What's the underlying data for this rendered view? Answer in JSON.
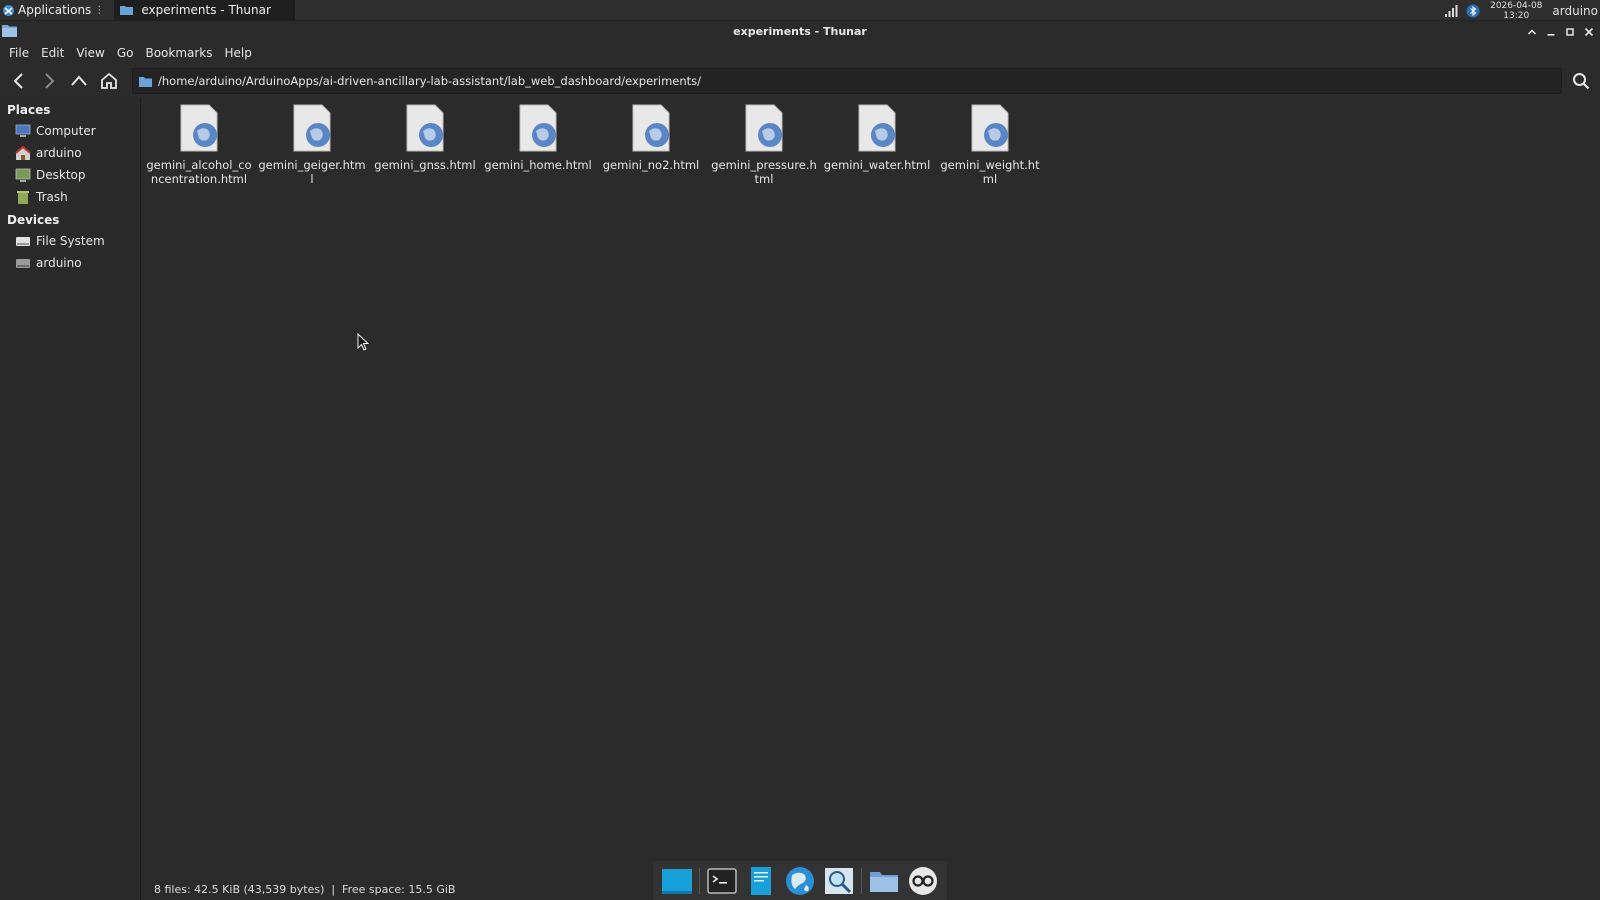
{
  "top_panel": {
    "applications_label": "Applications",
    "task_label": "experiments - Thunar",
    "clock_date": "2026-04-08",
    "clock_time": "13:20",
    "user": "arduino"
  },
  "window": {
    "title": "experiments - Thunar"
  },
  "menubar": {
    "items": [
      "File",
      "Edit",
      "View",
      "Go",
      "Bookmarks",
      "Help"
    ]
  },
  "toolbar": {
    "location": "/home/arduino/ArduinoApps/ai-driven-ancillary-lab-assistant/lab_web_dashboard/experiments/"
  },
  "sidebar": {
    "places_header": "Places",
    "places": [
      {
        "label": "Computer",
        "icon": "computer-icon"
      },
      {
        "label": "arduino",
        "icon": "home-icon"
      },
      {
        "label": "Desktop",
        "icon": "desktop-icon"
      },
      {
        "label": "Trash",
        "icon": "trash-icon"
      }
    ],
    "devices_header": "Devices",
    "devices": [
      {
        "label": "File System",
        "icon": "drive-icon"
      },
      {
        "label": "arduino",
        "icon": "drive-icon"
      }
    ]
  },
  "files": [
    {
      "name": "gemini_alcohol_concentration.html"
    },
    {
      "name": "gemini_geiger.html"
    },
    {
      "name": "gemini_gnss.html"
    },
    {
      "name": "gemini_home.html"
    },
    {
      "name": "gemini_no2.html"
    },
    {
      "name": "gemini_pressure.html"
    },
    {
      "name": "gemini_water.html"
    },
    {
      "name": "gemini_weight.html"
    }
  ],
  "statusbar": {
    "text": "8 files: 42.5 KiB (43,539 bytes)  |  Free space: 15.5 GiB"
  },
  "dock": {
    "items": [
      "show-desktop-icon",
      "terminal-icon",
      "text-editor-icon",
      "web-browser-icon",
      "search-icon",
      "file-manager-icon",
      "arduino-icon"
    ]
  },
  "colors": {
    "background": "#2b2b2b",
    "panel": "#2e2e2e",
    "accent": "#1aa0d8"
  }
}
